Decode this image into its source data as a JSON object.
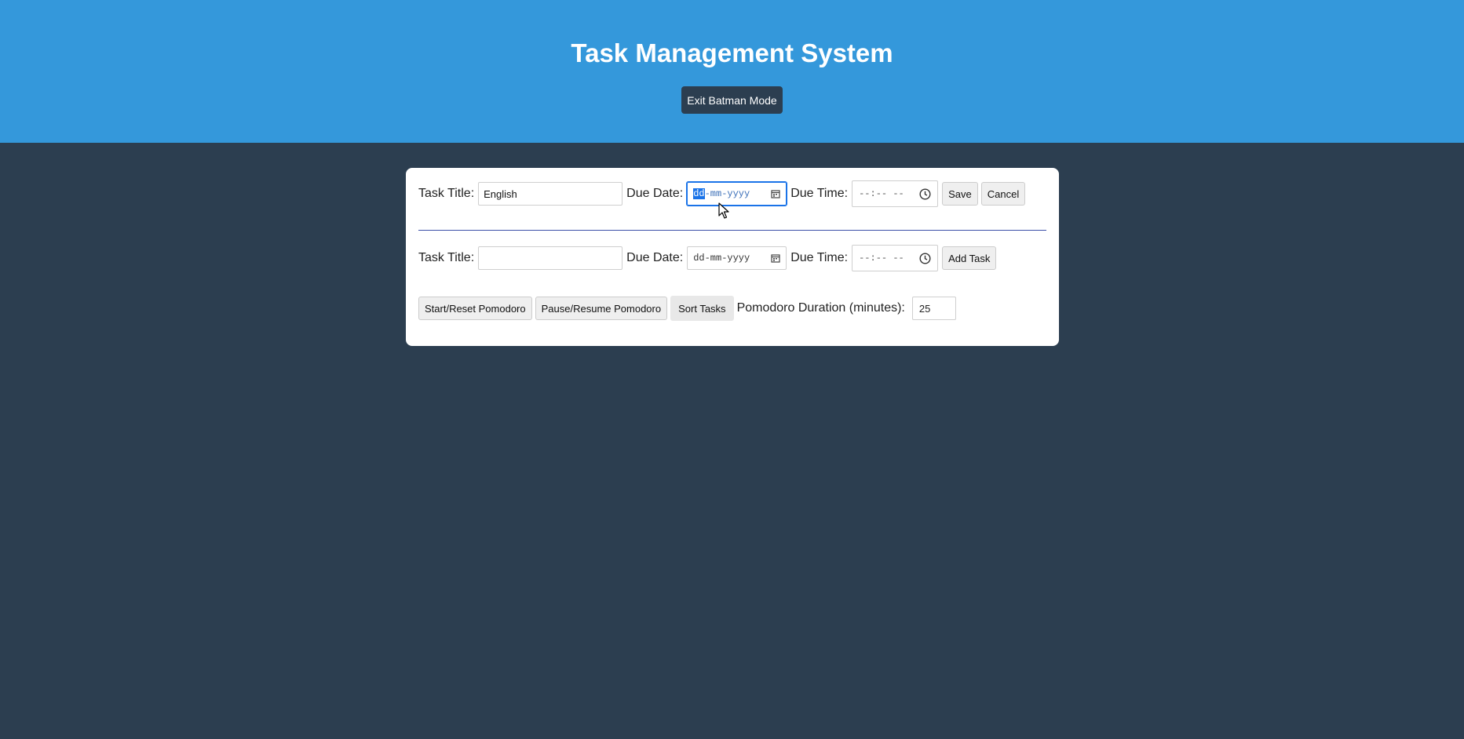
{
  "header": {
    "title": "Task Management System",
    "mode_button_label": "Exit Batman Mode"
  },
  "edit_form": {
    "title_label": "Task Title:",
    "title_value": "English",
    "date_label": "Due Date:",
    "date_segments": {
      "dd": "dd",
      "sep1": "-",
      "mm": "mm",
      "sep2": "-",
      "yyyy": "yyyy"
    },
    "time_label": "Due Time:",
    "time_placeholder": "--:-- --",
    "save_label": "Save",
    "cancel_label": "Cancel"
  },
  "add_form": {
    "title_label": "Task Title:",
    "title_value": "",
    "date_label": "Due Date:",
    "date_placeholder": "dd-mm-yyyy",
    "time_label": "Due Time:",
    "time_placeholder": "--:-- --",
    "add_label": "Add Task"
  },
  "pomodoro": {
    "start_reset_label": "Start/Reset Pomodoro",
    "pause_resume_label": "Pause/Resume Pomodoro",
    "sort_label": "Sort Tasks",
    "duration_label": "Pomodoro Duration (minutes):",
    "duration_value": "25"
  },
  "icons": [
    "calendar-icon",
    "clock-icon",
    "mouse-pointer-icon"
  ],
  "colors": {
    "header_bg": "#3498db",
    "page_bg": "#2c3e50",
    "card_bg": "#ffffff",
    "focus": "#1a73e8"
  }
}
